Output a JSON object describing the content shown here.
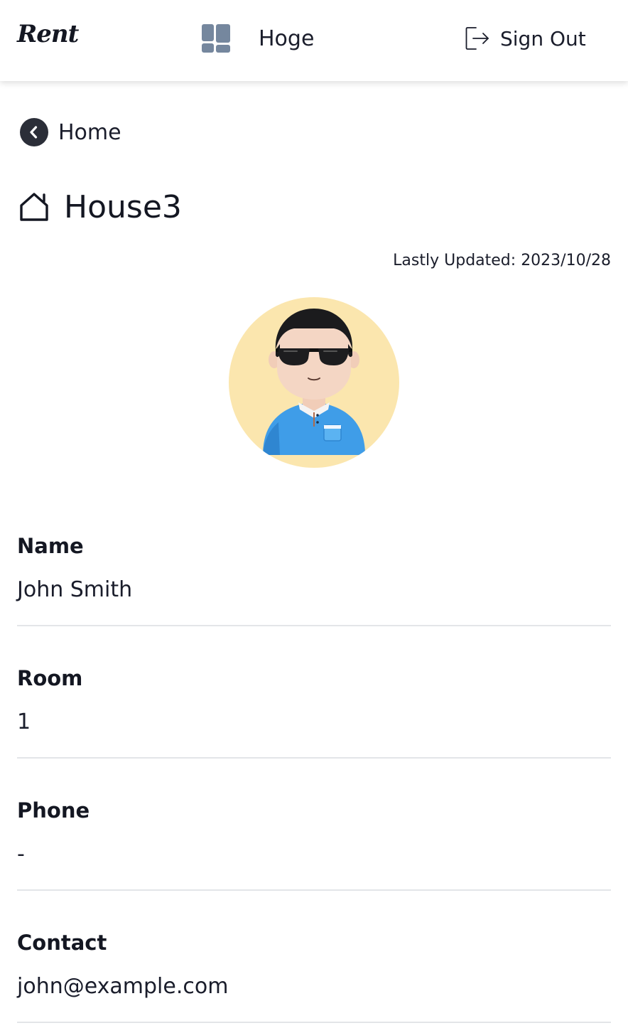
{
  "header": {
    "logo": "Rent",
    "workspace_label": "Hoge",
    "signout_label": "Sign Out"
  },
  "back": {
    "label": "Home"
  },
  "page": {
    "title": "House3",
    "updated_prefix": "Lastly Updated:",
    "updated_date": "2023/10/28"
  },
  "fields": [
    {
      "label": "Name",
      "value": "John Smith"
    },
    {
      "label": "Room",
      "value": "1"
    },
    {
      "label": "Phone",
      "value": "-"
    },
    {
      "label": "Contact",
      "value": "john@example.com"
    }
  ],
  "icons": {
    "workspace": "grid-icon",
    "signout": "sign-out-icon",
    "back": "chevron-left-circle-icon",
    "title": "house-icon"
  },
  "colors": {
    "grid_icon": "#75879e",
    "avatar_bg": "#fbe6ae",
    "shirt": "#3f9de8",
    "divider": "#e3e5e8",
    "text": "#1a1d2b"
  }
}
